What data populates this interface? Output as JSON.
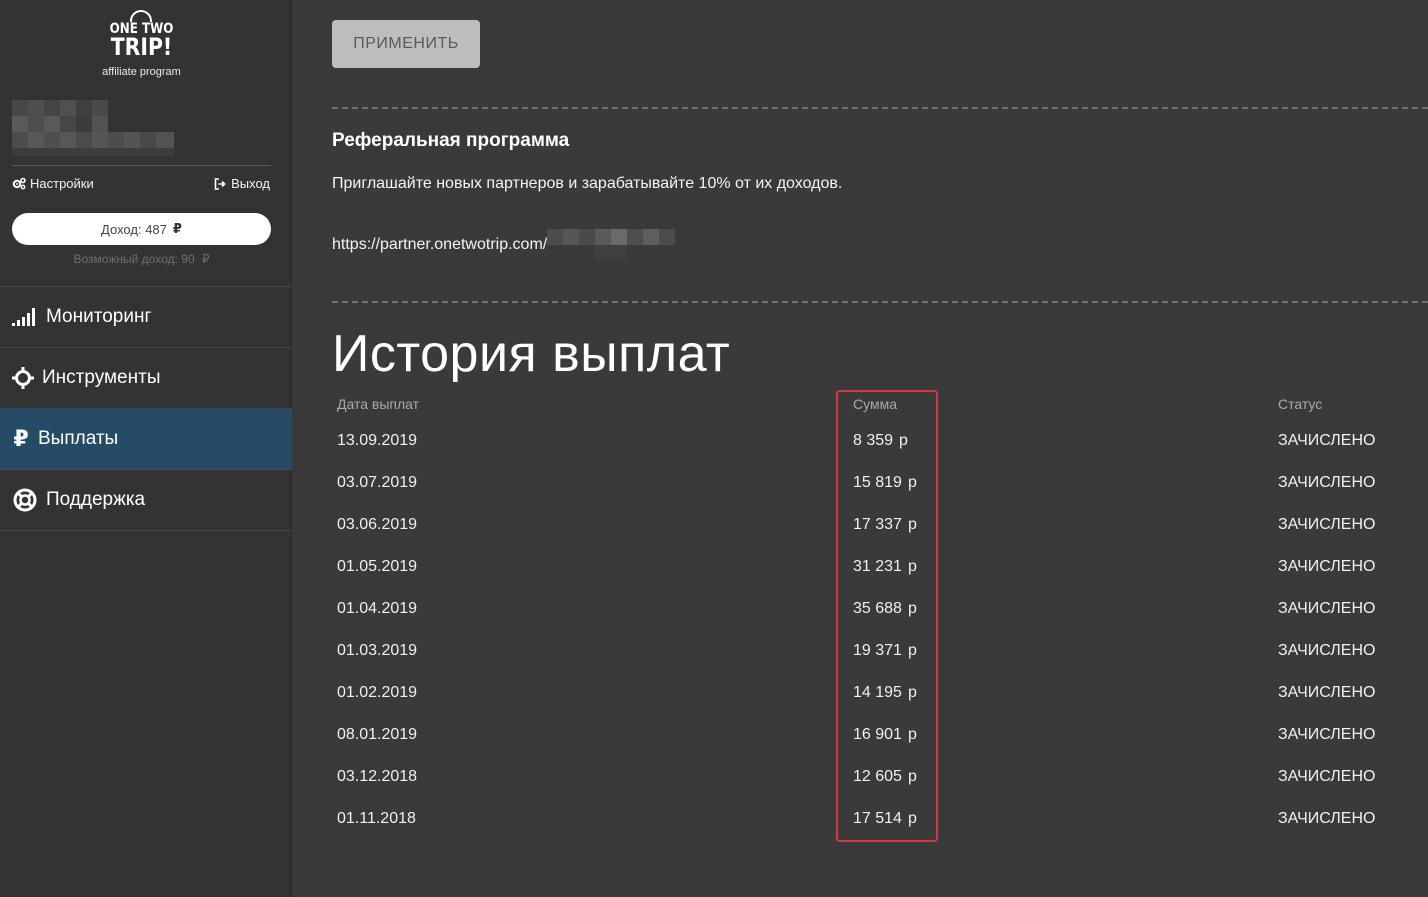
{
  "brand": {
    "line1": "ONE TWO",
    "line2": "TRIP!",
    "subtitle": "affiliate program"
  },
  "user": {
    "settings_label": "Настройки",
    "logout_label": "Выход",
    "income_label": "Доход: 487",
    "currency_symbol": "₽",
    "possible_income_label": "Возможный доход: 90"
  },
  "nav": [
    {
      "label": "Мониторинг",
      "icon": "signal-bars-icon",
      "active": false
    },
    {
      "label": "Инструменты",
      "icon": "crosshair-icon",
      "active": false
    },
    {
      "label": "Выплаты",
      "icon": "ruble-icon",
      "active": true
    },
    {
      "label": "Поддержка",
      "icon": "lifebuoy-icon",
      "active": false
    }
  ],
  "main": {
    "apply_button": "ПРИМЕНИТЬ",
    "referral_title": "Реферальная программа",
    "referral_text": "Приглашайте новых партнеров и зарабатывайте 10% от их доходов.",
    "referral_link": "https://partner.onetwotrip.com/",
    "history_title": "История выплат"
  },
  "payouts": {
    "headers": {
      "date": "Дата выплат",
      "sum": "Сумма",
      "status": "Статус"
    },
    "rows": [
      {
        "date": "13.09.2019",
        "sum": "8 359",
        "currency": "р",
        "status": "ЗАЧИСЛЕНО"
      },
      {
        "date": "03.07.2019",
        "sum": "15 819",
        "currency": "р",
        "status": "ЗАЧИСЛЕНО"
      },
      {
        "date": "03.06.2019",
        "sum": "17 337",
        "currency": "р",
        "status": "ЗАЧИСЛЕНО"
      },
      {
        "date": "01.05.2019",
        "sum": "31 231",
        "currency": "р",
        "status": "ЗАЧИСЛЕНО"
      },
      {
        "date": "01.04.2019",
        "sum": "35 688",
        "currency": "р",
        "status": "ЗАЧИСЛЕНО"
      },
      {
        "date": "01.03.2019",
        "sum": "19 371",
        "currency": "р",
        "status": "ЗАЧИСЛЕНО"
      },
      {
        "date": "01.02.2019",
        "sum": "14 195",
        "currency": "р",
        "status": "ЗАЧИСЛЕНО"
      },
      {
        "date": "08.01.2019",
        "sum": "16 901",
        "currency": "р",
        "status": "ЗАЧИСЛЕНО"
      },
      {
        "date": "03.12.2018",
        "sum": "12 605",
        "currency": "р",
        "status": "ЗАЧИСЛЕНО"
      },
      {
        "date": "01.11.2018",
        "sum": "17 514",
        "currency": "р",
        "status": "ЗАЧИСЛЕНО"
      }
    ]
  },
  "colors": {
    "background": "#3a3a3a",
    "sidebar": "#333333",
    "active_nav": "#264b66",
    "highlight_border": "#d9363e",
    "apply_button": "#bdbdbd"
  }
}
